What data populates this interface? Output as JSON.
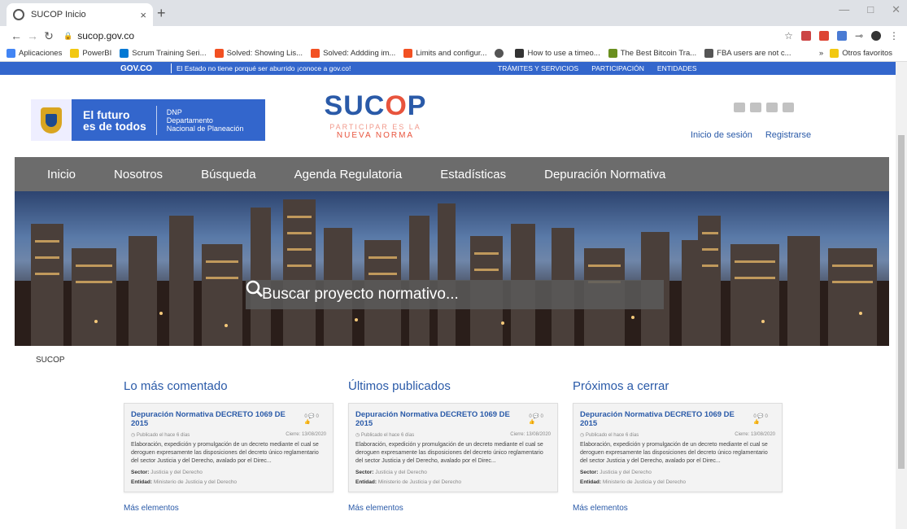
{
  "browser": {
    "tab_title": "SUCOP Inicio",
    "tab_close": "×",
    "new_tab": "+",
    "url": "sucop.gov.co",
    "bookmarks": [
      {
        "label": "Aplicaciones",
        "color": "#4285f4"
      },
      {
        "label": "PowerBI",
        "color": "#f2c811"
      },
      {
        "label": "Scrum Training Seri...",
        "color": "#0078d4"
      },
      {
        "label": "Solved: Showing Lis...",
        "color": "#f25022"
      },
      {
        "label": "Solved: Addding im...",
        "color": "#f25022"
      },
      {
        "label": "Limits and configur...",
        "color": "#f25022"
      },
      {
        "label": "",
        "color": "#555555"
      },
      {
        "label": "How to use a timeo...",
        "color": "#333333"
      },
      {
        "label": "The Best Bitcoin Tra...",
        "color": "#6a8f1f"
      },
      {
        "label": "FBA users are not c...",
        "color": "#555555"
      }
    ],
    "bookmarks_more": "»",
    "other_favorites": "Otros favoritos"
  },
  "govbar": {
    "logo": "GOV.CO",
    "message": "El Estado no tiene porqué ser aburrido ¡conoce a gov.co!",
    "links": [
      "TRÁMITES Y SERVICIOS",
      "PARTICIPACIÓN",
      "ENTIDADES"
    ]
  },
  "header": {
    "dnp_slogan_1": "El futuro",
    "dnp_slogan_2": "es de todos",
    "dnp_abbr": "DNP",
    "dnp_name_1": "Departamento",
    "dnp_name_2": "Nacional de Planeación",
    "sucop_left": "SUC",
    "sucop_q": "O",
    "sucop_right": "P",
    "tagline_1": "PARTICIPAR ES LA",
    "tagline_2": "NUEVA NORMA",
    "login": "Inicio de sesión",
    "register": "Registrarse"
  },
  "nav": [
    "Inicio",
    "Nosotros",
    "Búsqueda",
    "Agenda Regulatoria",
    "Estadísticas",
    "Depuración Normativa"
  ],
  "search": {
    "placeholder": "Buscar proyecto normativo..."
  },
  "breadcrumb": "SUCOP",
  "columns": [
    {
      "title": "Lo más comentado",
      "card": {
        "title": "Depuración Normativa DECRETO 1069 DE 2015",
        "stats": "0 💬 0 👍",
        "published": "Publicado el hace 6 días",
        "closes": "Cierre: 13/08/2020",
        "description": "Elaboración, expedición y promulgación de un decreto mediante el cual se deroguen expresamente las disposiciones del decreto único reglamentario del sector Justicia y del Derecho, avalado por el Direc...",
        "sector_label": "Sector:",
        "sector": "Justicia y del Derecho",
        "entity_label": "Entidad:",
        "entity": "Ministerio de Justicia y del Derecho"
      },
      "more": "Más elementos"
    },
    {
      "title": "Últimos publicados",
      "card": {
        "title": "Depuración Normativa DECRETO 1069 DE 2015",
        "stats": "0 💬 0 👍",
        "published": "Publicado el hace 6 días",
        "closes": "Cierre: 13/08/2020",
        "description": "Elaboración, expedición y promulgación de un decreto mediante el cual se deroguen expresamente las disposiciones del decreto único reglamentario del sector Justicia y del Derecho, avalado por el Direc...",
        "sector_label": "Sector:",
        "sector": "Justicia y del Derecho",
        "entity_label": "Entidad:",
        "entity": "Ministerio de Justicia y del Derecho"
      },
      "more": "Más elementos"
    },
    {
      "title": "Próximos a cerrar",
      "card": {
        "title": "Depuración Normativa DECRETO 1069 DE 2015",
        "stats": "0 💬 0 👍",
        "published": "Publicado el hace 6 días",
        "closes": "Cierre: 13/08/2020",
        "description": "Elaboración, expedición y promulgación de un decreto mediante el cual se deroguen expresamente las disposiciones del decreto único reglamentario del sector Justicia y del Derecho, avalado por el Direc...",
        "sector_label": "Sector:",
        "sector": "Justicia y del Derecho",
        "entity_label": "Entidad:",
        "entity": "Ministerio de Justicia y del Derecho"
      },
      "more": "Más elementos"
    }
  ]
}
